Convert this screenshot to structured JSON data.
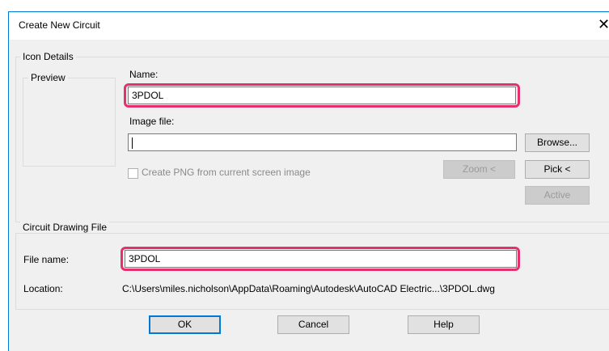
{
  "window": {
    "title": "Create New Circuit",
    "close_glyph": "✕"
  },
  "icon_details": {
    "legend": "Icon Details",
    "preview_legend": "Preview",
    "name_label": "Name:",
    "name_value": "3PDOL",
    "image_file_label": "Image file:",
    "image_file_value": "",
    "browse_label": "Browse...",
    "create_png_label": "Create PNG from current screen image",
    "create_png_checked": false,
    "zoom_label": "Zoom <",
    "pick_label": "Pick <",
    "active_label": "Active"
  },
  "circuit_drawing_file": {
    "legend": "Circuit Drawing File",
    "file_name_label": "File name:",
    "file_name_value": "3PDOL",
    "location_label": "Location:",
    "location_value": "C:\\Users\\miles.nicholson\\AppData\\Roaming\\Autodesk\\AutoCAD Electric...\\3PDOL.dwg"
  },
  "footer": {
    "ok_label": "OK",
    "cancel_label": "Cancel",
    "help_label": "Help"
  },
  "colors": {
    "highlight": "#e5306b",
    "accent": "#0078d7"
  }
}
